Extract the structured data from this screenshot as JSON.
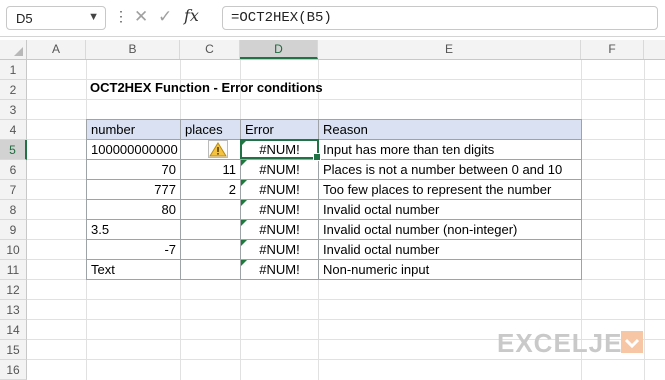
{
  "formula_bar": {
    "name_box": "D5",
    "formula": "=OCT2HEX(B5)",
    "fx_label": "fx",
    "cancel_glyph": "✕",
    "enter_glyph": "✓"
  },
  "columns": [
    "A",
    "B",
    "C",
    "D",
    "E",
    "F"
  ],
  "rows": [
    "1",
    "2",
    "3",
    "4",
    "5",
    "6",
    "7",
    "8",
    "9",
    "10",
    "11",
    "12",
    "13",
    "14",
    "15",
    "16"
  ],
  "selected_cell": "D5",
  "sheet": {
    "title": "OCT2HEX Function - Error conditions",
    "headers": {
      "number": "number",
      "places": "places",
      "error": "Error",
      "reason": "Reason"
    },
    "rows": [
      {
        "number": "100000000000",
        "places": "",
        "error": "#NUM!",
        "reason": "Input has more than ten digits"
      },
      {
        "number": "70",
        "places": "11",
        "error": "#NUM!",
        "reason": "Places is not a number between 0 and 10"
      },
      {
        "number": "777",
        "places": "2",
        "error": "#NUM!",
        "reason": "Too few places to represent the number"
      },
      {
        "number": "80",
        "places": "",
        "error": "#NUM!",
        "reason": "Invalid octal number"
      },
      {
        "number": "3.5",
        "places": "",
        "error": "#NUM!",
        "reason": "Invalid octal number (non-integer)"
      },
      {
        "number": "-7",
        "places": "",
        "error": "#NUM!",
        "reason": "Invalid octal number"
      },
      {
        "number": "Text",
        "places": "",
        "error": "#NUM!",
        "reason": "Non-numeric input"
      }
    ]
  },
  "logo": {
    "text": "EXCELJET"
  },
  "icons": {
    "warning": "warning-icon",
    "dots": "more-options-icon"
  },
  "colors": {
    "header_fill": "#d9e1f2",
    "selection": "#217346",
    "error_marker": "#1e7a3c"
  }
}
